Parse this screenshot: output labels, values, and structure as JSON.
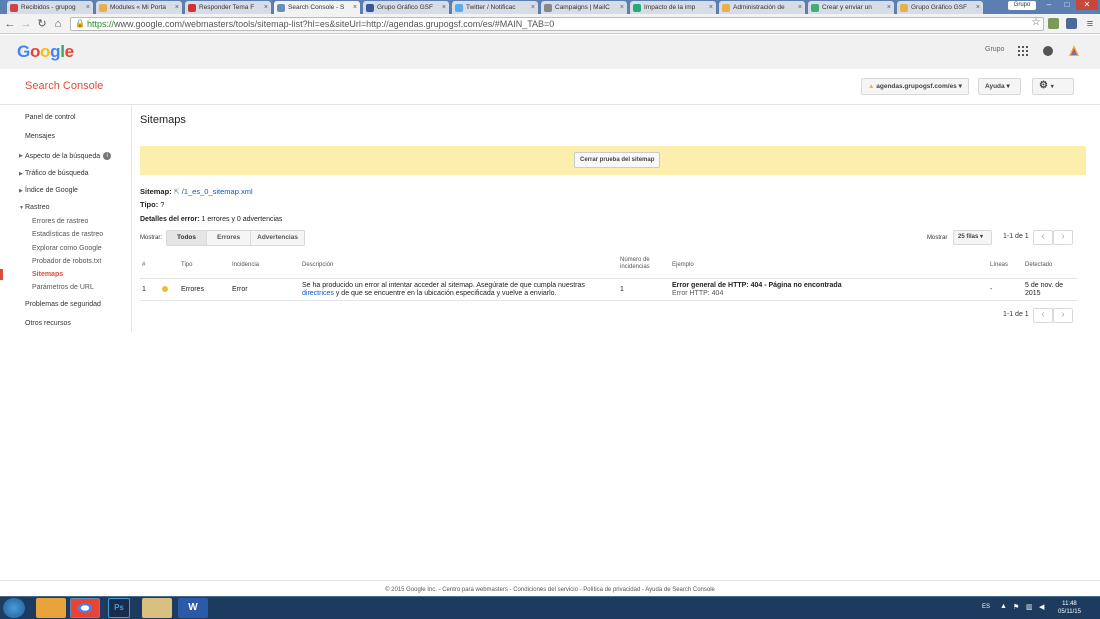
{
  "browser": {
    "tabs": [
      {
        "label": "Recibidos - grupog",
        "color": "#c44"
      },
      {
        "label": "Modules « Mi Porta",
        "color": "#e8b04a"
      },
      {
        "label": "Responder Tema F",
        "color": "#c33"
      },
      {
        "label": "Search Console - S",
        "color": "#6c8ebf",
        "active": true
      },
      {
        "label": "Grupo Gráfico GSF",
        "color": "#3b5998"
      },
      {
        "label": "Twitter / Notificac",
        "color": "#55acee"
      },
      {
        "label": "Campaigns | MailC",
        "color": "#888"
      },
      {
        "label": "Impacto de la imp",
        "color": "#2a7"
      },
      {
        "label": "Administración de",
        "color": "#e8b04a"
      },
      {
        "label": "Crear y enviar un",
        "color": "#4a7"
      },
      {
        "label": "Grupo Gráfico GSF",
        "color": "#e8b04a"
      }
    ],
    "user_chip": "Grupo",
    "url_scheme": "https://",
    "url_rest": "www.google.com/webmasters/tools/sitemap-list?hl=es&siteUrl=http://agendas.grupogsf.com/es/#MAIN_TAB=0"
  },
  "google_header": {
    "logo": "Google",
    "account_link": "Grupo"
  },
  "sc": {
    "title": "Search Console",
    "site_selector": "agendas.grupogsf.com/es",
    "help_label": "Ayuda"
  },
  "sidebar": {
    "items": [
      {
        "label": "Panel de control"
      },
      {
        "label": "Mensajes"
      },
      {
        "label": "Aspecto de la búsqueda"
      },
      {
        "label": "Tráfico de búsqueda"
      },
      {
        "label": "Índice de Google"
      },
      {
        "label": "Rastreo"
      },
      {
        "label": "Errores de rastreo"
      },
      {
        "label": "Estadísticas de rastreo"
      },
      {
        "label": "Explorar como Google"
      },
      {
        "label": "Probador de robots.txt"
      },
      {
        "label": "Sitemaps"
      },
      {
        "label": "Parámetros de URL"
      },
      {
        "label": "Problemas de seguridad"
      },
      {
        "label": "Otros recursos"
      }
    ]
  },
  "main": {
    "title": "Sitemaps",
    "close_test_label": "Cerrar prueba del sitemap",
    "sitemap_label": "Sitemap:",
    "sitemap_url": "/1_es_0_sitemap.xml",
    "type_label": "Tipo:",
    "type_value": "?",
    "details_label": "Detalles del error:",
    "details_value": "1 errores y 0 advertencias",
    "show_label": "Mostrar:",
    "filters": [
      "Todos",
      "Errores",
      "Advertencias"
    ],
    "rows_label": "Mostrar",
    "rows_value": "25 filas",
    "pagination": "1-1 de 1"
  },
  "table": {
    "headers": {
      "num": "#",
      "type": "Tipo",
      "incidence": "Incidencia",
      "description": "Descripción",
      "count": "Número de incidencias",
      "example": "Ejemplo",
      "lines": "Líneas",
      "detected": "Detectado"
    },
    "row": {
      "num": "1",
      "type": "Errores",
      "incidence": "Error",
      "desc_before": "Se ha producido un error al intentar acceder al sitemap. Asegúrate de que cumpla nuestras",
      "desc_link": "directrices",
      "desc_after": "y de que se encuentre en la ubicación especificada y vuelve a enviarlo.",
      "count": "1",
      "example_title": "Error general de HTTP: 404 - Página no encontrada",
      "example_sub": "Error HTTP: 404",
      "lines": "-",
      "detected": "5 de nov. de 2015"
    }
  },
  "footer": "© 2015 Google Inc. - Centro para webmasters - Condiciones del servicio - Política de privacidad - Ayuda de Search Console",
  "taskbar": {
    "lang": "ES",
    "time": "11:48",
    "date": "05/11/15"
  }
}
